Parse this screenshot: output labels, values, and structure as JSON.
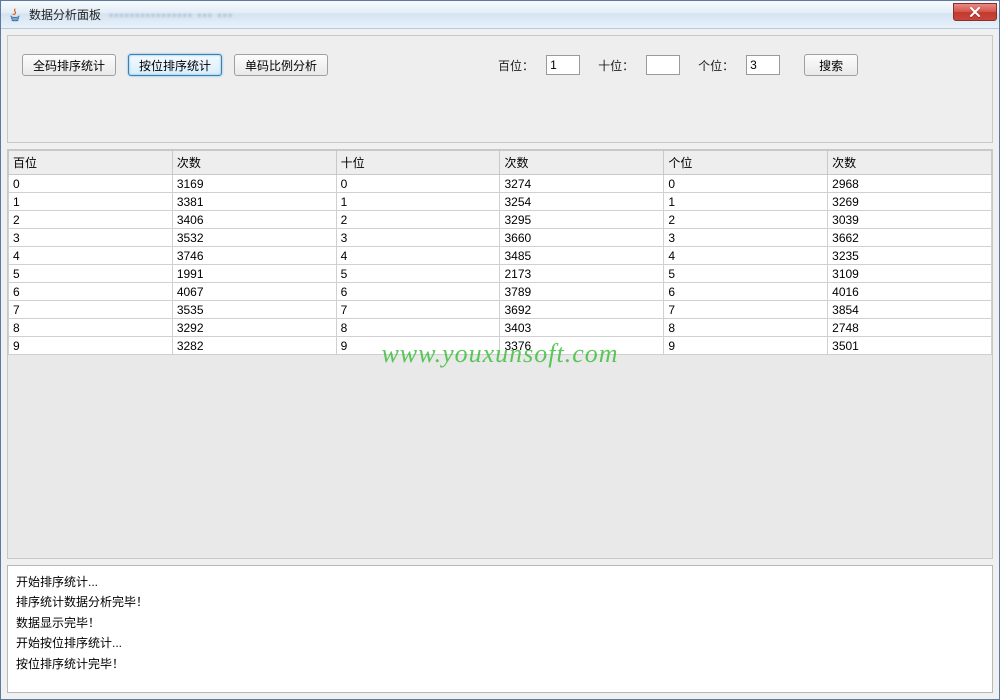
{
  "window": {
    "title": "数据分析面板",
    "ghost_subtitle": "▪▪▪▪▪▪▪▪▪▪▪▪▪▪▪▪  ▪▪▪  ▪▪▪"
  },
  "toolbar": {
    "btn_full_sort": "全码排序统计",
    "btn_pos_sort": "按位排序统计",
    "btn_ratio": "单码比例分析",
    "label_bai": "百位：",
    "label_shi": "十位：",
    "label_ge": "个位：",
    "input_bai": "1",
    "input_shi": "",
    "input_ge": "3",
    "btn_search": "搜索"
  },
  "table": {
    "headers": [
      "百位",
      "次数",
      "十位",
      "次数",
      "个位",
      "次数"
    ],
    "rows": [
      [
        "0",
        "3169",
        "0",
        "3274",
        "0",
        "2968"
      ],
      [
        "1",
        "3381",
        "1",
        "3254",
        "1",
        "3269"
      ],
      [
        "2",
        "3406",
        "2",
        "3295",
        "2",
        "3039"
      ],
      [
        "3",
        "3532",
        "3",
        "3660",
        "3",
        "3662"
      ],
      [
        "4",
        "3746",
        "4",
        "3485",
        "4",
        "3235"
      ],
      [
        "5",
        "1991",
        "5",
        "2173",
        "5",
        "3109"
      ],
      [
        "6",
        "4067",
        "6",
        "3789",
        "6",
        "4016"
      ],
      [
        "7",
        "3535",
        "7",
        "3692",
        "7",
        "3854"
      ],
      [
        "8",
        "3292",
        "8",
        "3403",
        "8",
        "2748"
      ],
      [
        "9",
        "3282",
        "9",
        "3376",
        "9",
        "3501"
      ]
    ]
  },
  "watermark": "www.youxunsoft.com",
  "log": {
    "lines": [
      "开始排序统计...",
      "排序统计数据分析完毕！",
      "数据显示完毕！",
      "开始按位排序统计...",
      "按位排序统计完毕！"
    ]
  }
}
